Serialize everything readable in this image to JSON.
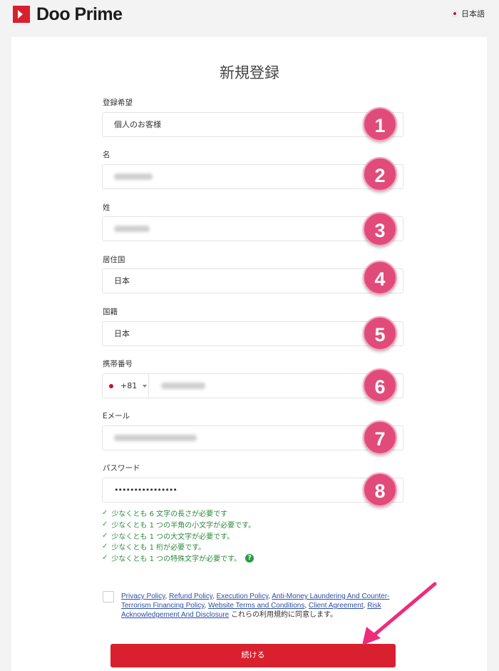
{
  "brand": {
    "name": "Doo Prime",
    "accent": "#d9202e"
  },
  "language": {
    "label": "日本語"
  },
  "form": {
    "title": "新規登録",
    "fields": [
      {
        "label": "登録希望",
        "value": "個人のお客様"
      },
      {
        "label": "名",
        "value": ""
      },
      {
        "label": "姓",
        "value": ""
      },
      {
        "label": "居住国",
        "value": "日本"
      },
      {
        "label": "国籍",
        "value": "日本"
      },
      {
        "label": "携帯番号",
        "prefix": "+81",
        "value": ""
      },
      {
        "label": "Eメール",
        "value": ""
      },
      {
        "label": "パスワード",
        "value": "••••••••••••••••"
      }
    ],
    "badges": [
      "1",
      "2",
      "3",
      "4",
      "5",
      "6",
      "7",
      "8"
    ],
    "password_rules": [
      "少なくとも 6 文字の長さが必要です",
      "少なくとも 1 つの半角の小文字が必要です。",
      "少なくとも 1 つの大文字が必要です。",
      "少なくとも 1 桁が必要です。",
      "少なくとも 1 つの特殊文字が必要です。"
    ],
    "terms_links": [
      "Privacy Policy",
      "Refund Policy",
      "Execution Policy",
      "Anti-Money Laundering And Counter-Terrorism Financing Policy",
      "Website Terms and Conditions",
      "Client Agreement",
      "Risk Acknowledgement And Disclosure"
    ],
    "terms_suffix": "これらの利用規約に同意します。",
    "submit_label": "続ける"
  }
}
